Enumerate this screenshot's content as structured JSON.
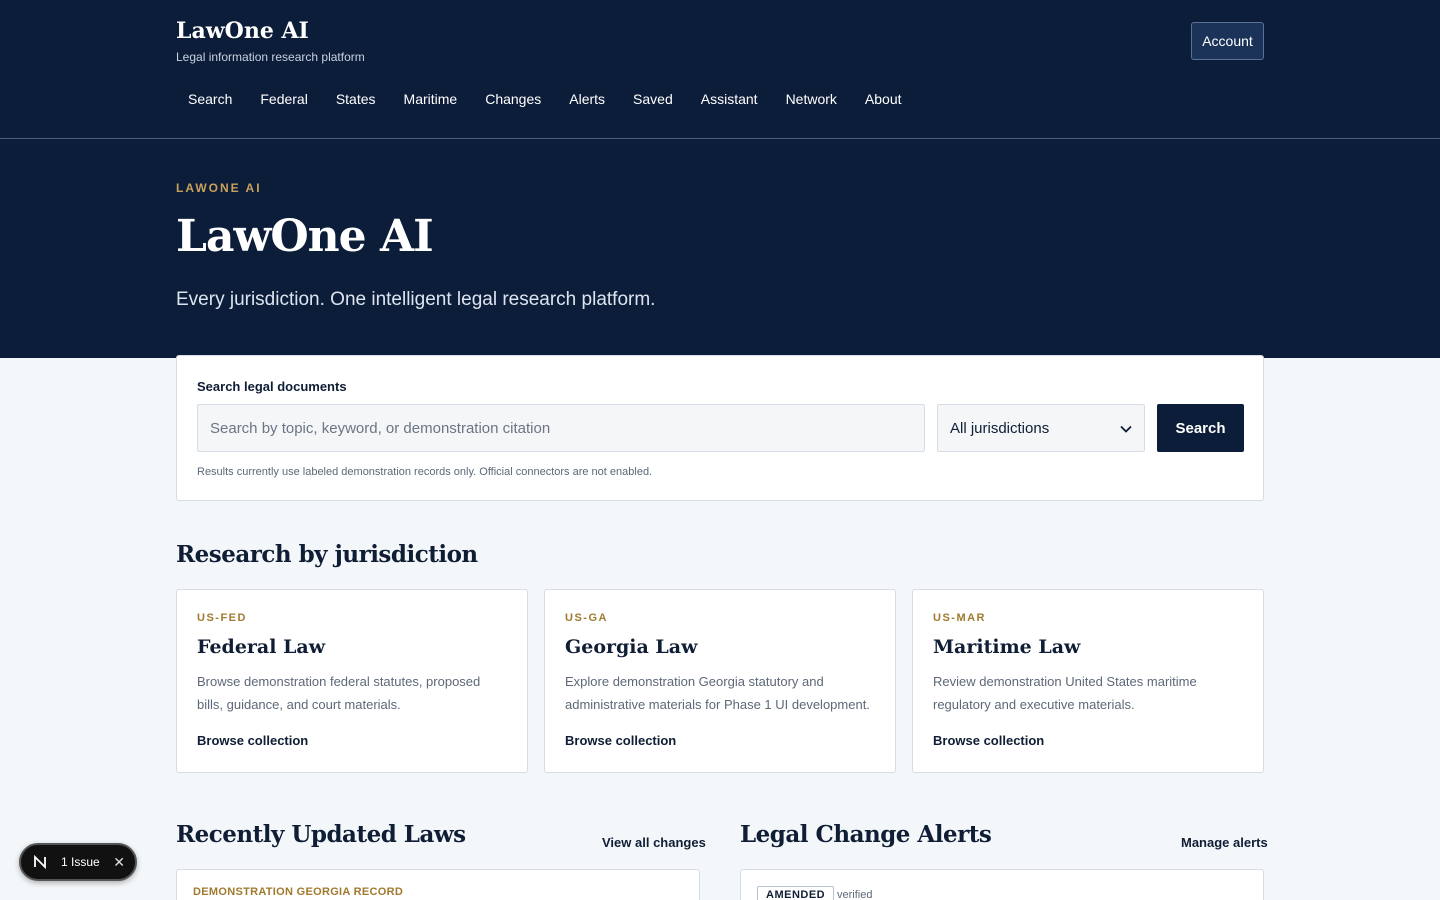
{
  "header": {
    "brand_title": "LawOne AI",
    "brand_subtitle": "Legal information research platform",
    "account_label": "Account",
    "nav": [
      "Search",
      "Federal",
      "States",
      "Maritime",
      "Changes",
      "Alerts",
      "Saved",
      "Assistant",
      "Network",
      "About"
    ]
  },
  "hero": {
    "eyebrow": "LAWONE AI",
    "title": "LawOne AI",
    "subtitle": "Every jurisdiction. One intelligent legal research platform."
  },
  "search": {
    "label": "Search legal documents",
    "placeholder": "Search by topic, keyword, or demonstration citation",
    "value": "",
    "jurisdiction_selected": "All jurisdictions",
    "button_label": "Search",
    "note": "Results currently use labeled demonstration records only. Official connectors are not enabled."
  },
  "jurisdictions": {
    "title": "Research by jurisdiction",
    "cards": [
      {
        "code": "US-FED",
        "title": "Federal Law",
        "description": "Browse demonstration federal statutes, proposed bills, guidance, and court materials.",
        "link": "Browse collection"
      },
      {
        "code": "US-GA",
        "title": "Georgia Law",
        "description": "Explore demonstration Georgia statutory and administrative materials for Phase 1 UI development.",
        "link": "Browse collection"
      },
      {
        "code": "US-MAR",
        "title": "Maritime Law",
        "description": "Review demonstration United States maritime regulatory and executive materials.",
        "link": "Browse collection"
      }
    ]
  },
  "recent": {
    "title": "Recently Updated Laws",
    "link": "View all changes",
    "first_record_label": "DEMONSTRATION GEORGIA RECORD"
  },
  "alerts": {
    "title": "Legal Change Alerts",
    "link": "Manage alerts",
    "first_badge": "AMENDED",
    "first_status": "verified"
  },
  "dev_overlay": {
    "issue_count": "1 Issue",
    "logo_icon": "n-logo-icon",
    "close_icon": "close-icon"
  },
  "colors": {
    "navy": "#0c1d3a",
    "gold": "#c9a25a",
    "background": "#f4f7fa"
  }
}
